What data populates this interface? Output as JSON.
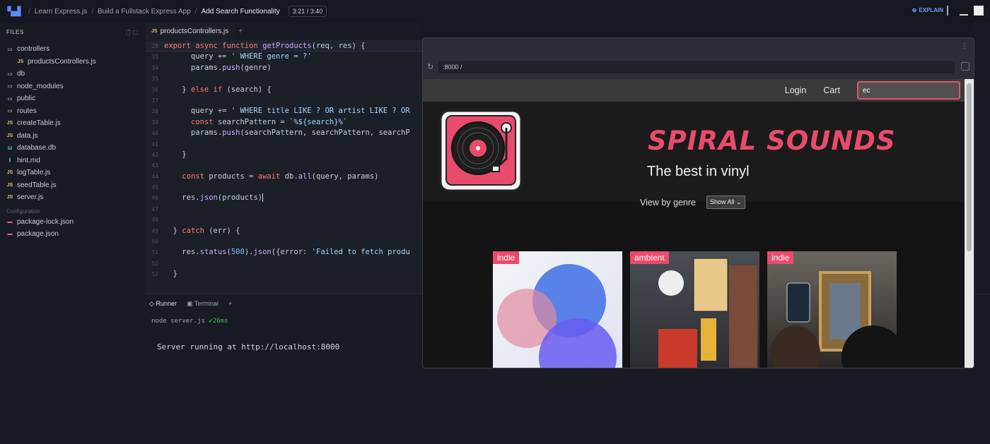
{
  "topbar": {
    "breadcrumbs": [
      "Learn Express.js",
      "Build a Fullstack Express App",
      "Add Search Functionality"
    ],
    "time": "3:21 / 3:40",
    "explain": "EXPLAIN"
  },
  "sidebar": {
    "header": "FILES",
    "items": [
      {
        "label": "controllers",
        "type": "folder"
      },
      {
        "label": "productsControllers.js",
        "type": "js",
        "indent": true
      },
      {
        "label": "db",
        "type": "folder"
      },
      {
        "label": "node_modules",
        "type": "folder"
      },
      {
        "label": "public",
        "type": "folder"
      },
      {
        "label": "routes",
        "type": "folder"
      },
      {
        "label": "createTable.js",
        "type": "js"
      },
      {
        "label": "data.js",
        "type": "js"
      },
      {
        "label": "database.db",
        "type": "db"
      },
      {
        "label": "hint.md",
        "type": "md"
      },
      {
        "label": "logTable.js",
        "type": "js"
      },
      {
        "label": "seedTable.js",
        "type": "js"
      },
      {
        "label": "server.js",
        "type": "js"
      }
    ],
    "config_section": "Configuration",
    "config_items": [
      "package-lock.json",
      "package.json"
    ]
  },
  "editor": {
    "tab": "productsControllers.js",
    "sticky_line_no": "28",
    "line_numbers": [
      "33",
      "34",
      "35",
      "36",
      "37",
      "38",
      "39",
      "40",
      "41",
      "42",
      "43",
      "44",
      "45",
      "46",
      "47",
      "48",
      "49",
      "50",
      "51",
      "52",
      "53"
    ]
  },
  "runner": {
    "tabs": [
      "Runner",
      "Terminal"
    ],
    "command": "node server.js",
    "duration": "✔26ms",
    "output": "Server running at http://localhost:8000"
  },
  "browser": {
    "url": ":8000 /",
    "site": {
      "nav": [
        "Login",
        "Cart"
      ],
      "search_value": "ec",
      "brand": "SPIRAL SOUNDS",
      "tagline": "The best in vinyl",
      "genre_label": "View by genre",
      "genre_selected": "Show All",
      "cards": [
        {
          "genre": "indie"
        },
        {
          "genre": "ambient"
        },
        {
          "genre": "indie"
        }
      ]
    }
  },
  "colors": {
    "accent": "#e94b6d",
    "editor_bg": "#1b1f28",
    "sidebar_bg": "#181b23"
  }
}
